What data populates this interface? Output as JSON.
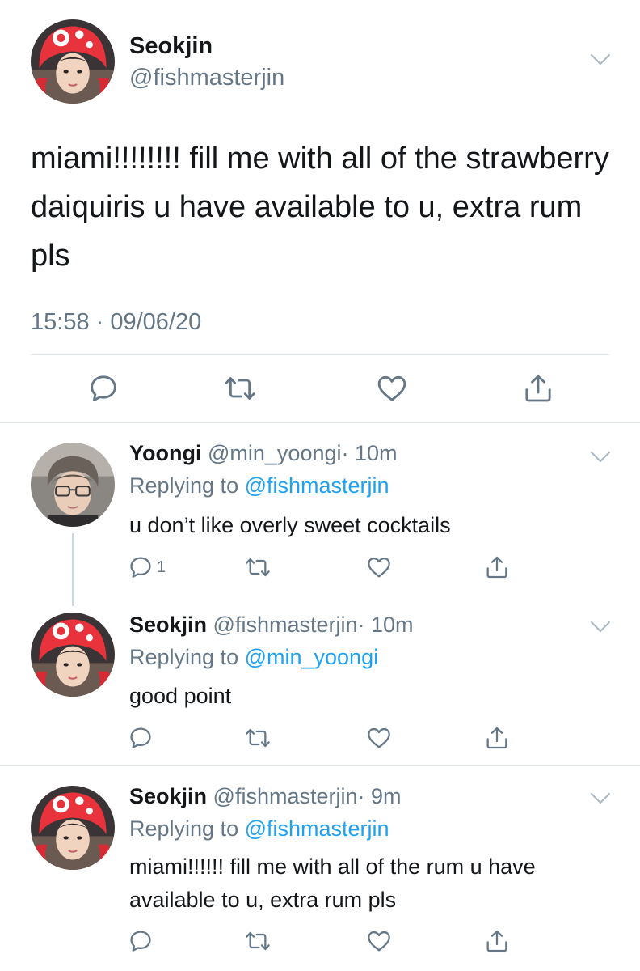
{
  "main_tweet": {
    "name": "Seokjin",
    "handle": "@fishmasterjin",
    "text": "miami!!!!!!!! fill me with all of the strawberry daiquiris u have available to u, extra rum pls",
    "timestamp": "15:58 · 09/06/20",
    "actions": [
      "reply-icon",
      "retweet-icon",
      "like-icon",
      "share-icon"
    ]
  },
  "replies": [
    {
      "name": "Yoongi",
      "handle": "@min_yoongi",
      "time": "· 10m",
      "replying_prefix": "Replying to ",
      "replying_to": "@fishmasterjin",
      "text": "u don’t like overly sweet cocktails",
      "reply_count": "1"
    },
    {
      "name": "Seokjin",
      "handle": "@fishmasterjin",
      "time": "· 10m",
      "replying_prefix": "Replying to ",
      "replying_to": "@min_yoongi",
      "text": "good point",
      "reply_count": ""
    },
    {
      "name": "Seokjin",
      "handle": "@fishmasterjin",
      "time": "· 9m",
      "replying_prefix": "Replying to ",
      "replying_to": "@fishmasterjin",
      "text": "miami!!!!!! fill me with all of the rum u have available to u, extra rum pls",
      "reply_count": ""
    }
  ],
  "colors": {
    "text": "#14171a",
    "secondary": "#657786",
    "link": "#1da1f2",
    "divider": "#e1e8ed",
    "avatar_hat_red": "#e8323c"
  }
}
